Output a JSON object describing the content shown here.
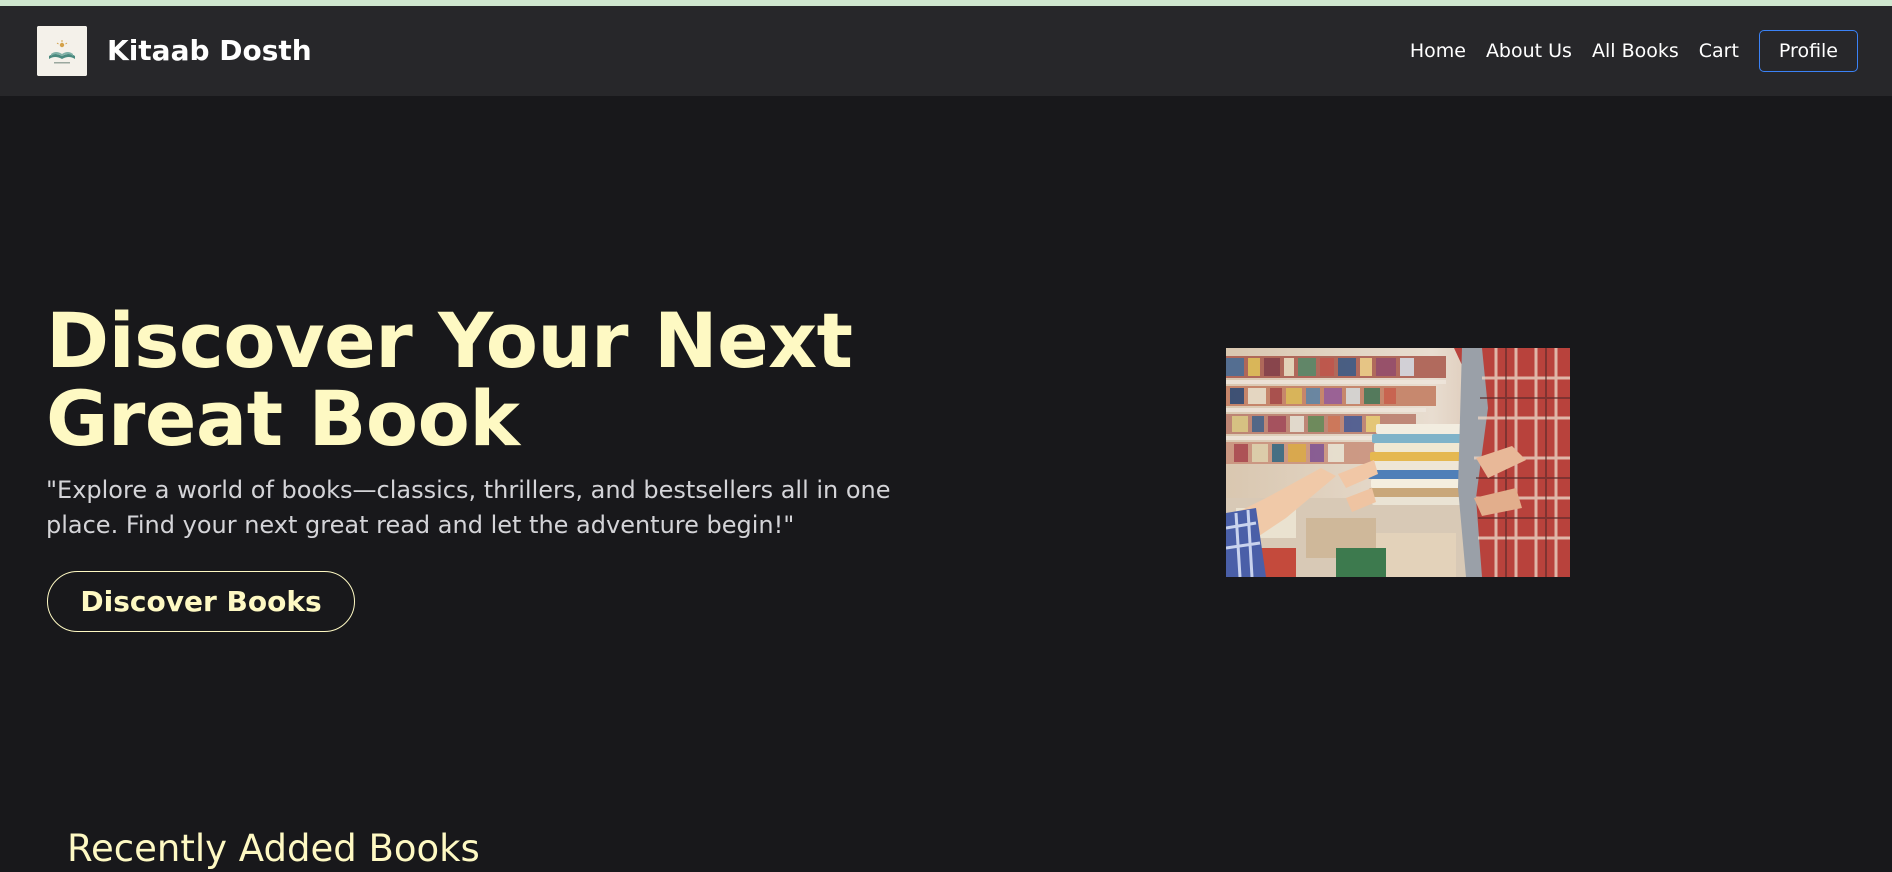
{
  "brand": {
    "name": "Kitaab Dosth",
    "logo_icon": "open-book-logo-icon"
  },
  "nav": {
    "links": [
      "Home",
      "About Us",
      "All Books",
      "Cart"
    ],
    "profile_label": "Profile"
  },
  "hero": {
    "title": "Discover Your Next Great Book",
    "subtitle": "\"Explore a world of books—classics, thrillers, and bestsellers all in one place. Find your next great read and let the adventure begin!\"",
    "cta_label": "Discover Books",
    "image": "bookstore-handing-stack-of-books-photo"
  },
  "sections": {
    "recent_title": "Recently Added Books"
  },
  "colors": {
    "background": "#18181b",
    "navbar": "#27272a",
    "accent": "#fef9c3",
    "profile_border": "#3b82f6",
    "top_strip": "#cfe7cf"
  }
}
